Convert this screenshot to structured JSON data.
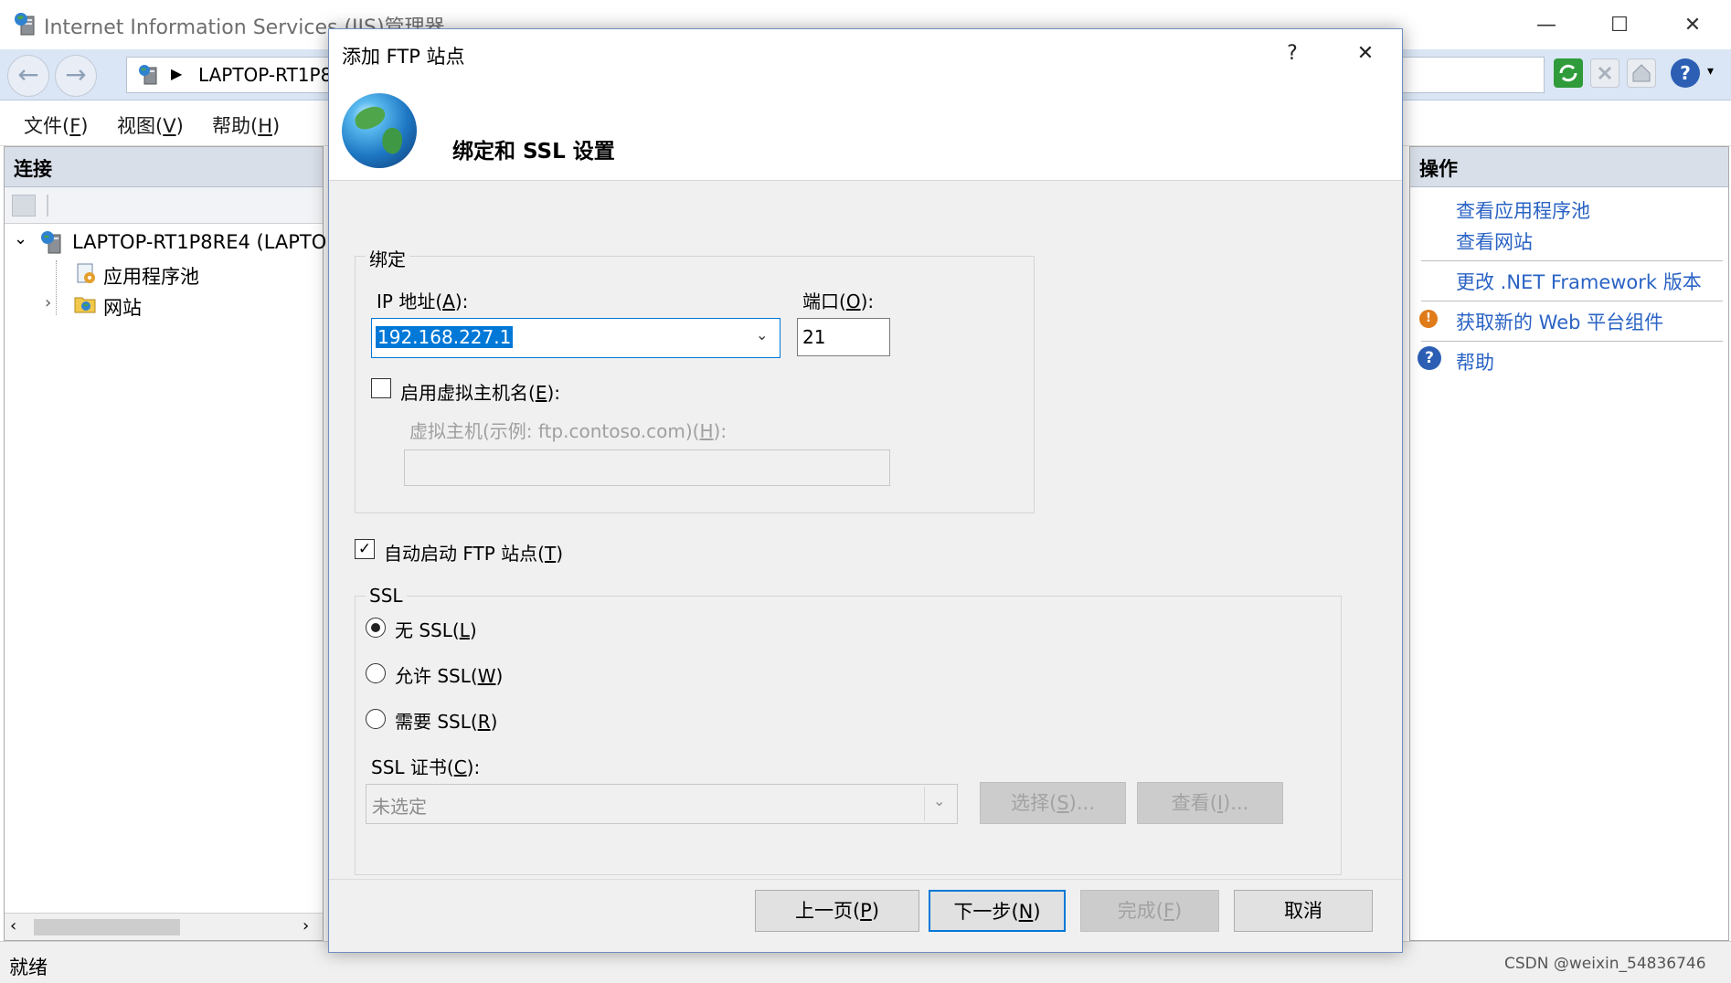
{
  "window": {
    "title": "Internet Information Services (IIS)管理器",
    "minimize": "—",
    "maximize": "☐",
    "close": "✕"
  },
  "navbar": {
    "back": "←",
    "forward": "→",
    "breadcrumb": "LAPTOP-RT1P8"
  },
  "menu": {
    "file": "文件",
    "file_key": "F",
    "view": "视图",
    "view_key": "V",
    "help": "帮助",
    "help_key": "H"
  },
  "connections": {
    "title": "连接",
    "server": "LAPTOP-RT1P8RE4 (LAPTOP",
    "app_pools": "应用程序池",
    "sites": "网站"
  },
  "actions": {
    "title": "操作",
    "view_app_pools": "查看应用程序池",
    "view_sites": "查看网站",
    "change_net": "更改 .NET Framework 版本",
    "get_web_components": "获取新的 Web 平台组件",
    "help": "帮助"
  },
  "status": {
    "text": "就绪",
    "watermark": "CSDN @weixin_54836746"
  },
  "dialog": {
    "title": "添加 FTP 站点",
    "help_btn": "?",
    "close_btn": "✕",
    "heading": "绑定和 SSL 设置",
    "binding": {
      "group": "绑定",
      "ip_label": "IP 地址",
      "ip_key": "A",
      "ip_value": "192.168.227.1",
      "port_label": "端口",
      "port_key": "O",
      "port_value": "21",
      "vhost_label": "启用虚拟主机名",
      "vhost_key": "E",
      "vhost_checked": false,
      "vhost_host_label": "虚拟主机(示例: ftp.contoso.com)",
      "vhost_host_key": "H",
      "vhost_host_value": ""
    },
    "autostart_label": "自动启动 FTP 站点",
    "autostart_key": "T",
    "autostart_checked": true,
    "ssl": {
      "group": "SSL",
      "none": "无 SSL",
      "none_key": "L",
      "allow": "允许 SSL",
      "allow_key": "W",
      "require": "需要 SSL",
      "require_key": "R",
      "selected": "none",
      "cert_label": "SSL 证书",
      "cert_key": "C",
      "cert_value": "未选定",
      "select_btn": "选择",
      "select_key": "S",
      "view_btn": "查看",
      "view_key": "I"
    },
    "buttons": {
      "prev": "上一页",
      "prev_key": "P",
      "next": "下一步",
      "next_key": "N",
      "finish": "完成",
      "finish_key": "F",
      "cancel": "取消"
    }
  }
}
